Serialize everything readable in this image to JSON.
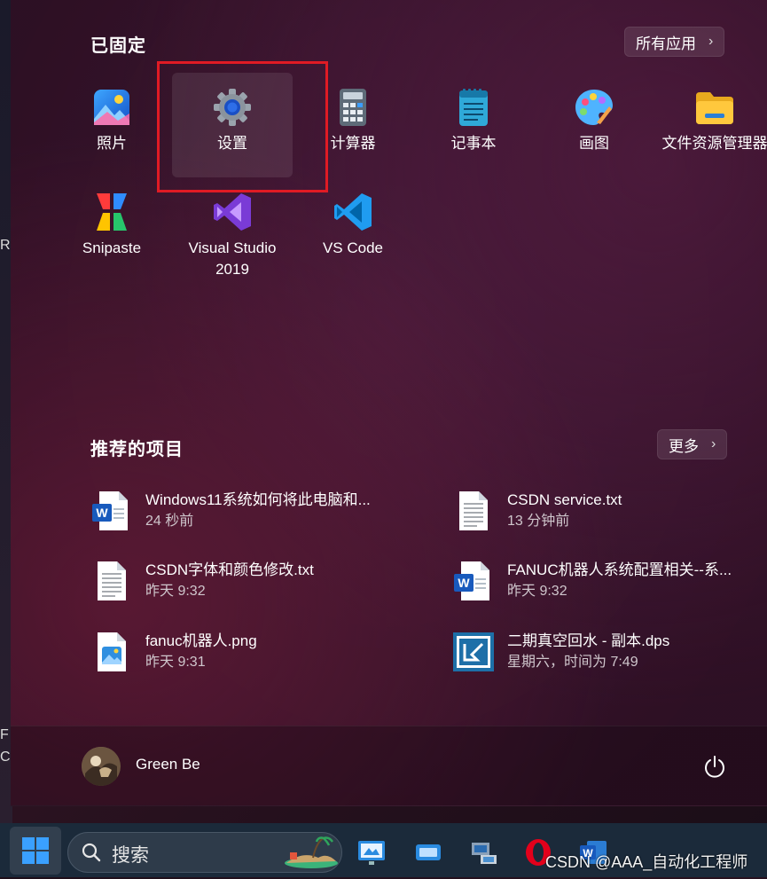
{
  "desktop": {
    "chars": [
      "R",
      "F",
      "C"
    ]
  },
  "pinned": {
    "title": "已固定",
    "all_apps": "所有应用",
    "apps": [
      {
        "label": "照片",
        "icon": "photos-icon"
      },
      {
        "label": "设置",
        "icon": "gear-icon",
        "selected": true
      },
      {
        "label": "计算器",
        "icon": "calculator-icon"
      },
      {
        "label": "记事本",
        "icon": "notepad-icon"
      },
      {
        "label": "画图",
        "icon": "paint-icon"
      },
      {
        "label": "文件资源管理器",
        "icon": "folder-icon"
      },
      {
        "label": "Snipaste",
        "icon": "snipaste-icon"
      },
      {
        "label": "Visual Studio 2019",
        "label_line1": "Visual Studio",
        "label_line2": "2019",
        "icon": "visual-studio-icon"
      },
      {
        "label": "VS Code",
        "icon": "vscode-icon"
      }
    ]
  },
  "recommended": {
    "title": "推荐的项目",
    "more": "更多",
    "items": [
      {
        "name": "Windows11系统如何将此电脑和...",
        "time": "24 秒前",
        "icon": "word-doc-icon"
      },
      {
        "name": "CSDN service.txt",
        "time": "13 分钟前",
        "icon": "text-file-icon"
      },
      {
        "name": "CSDN字体和颜色修改.txt",
        "time": "昨天 9:32",
        "icon": "text-file-icon"
      },
      {
        "name": "FANUC机器人系统配置相关--系...",
        "time": "昨天 9:32",
        "icon": "word-doc-icon"
      },
      {
        "name": "fanuc机器人.png",
        "time": "昨天 9:31",
        "icon": "image-file-icon"
      },
      {
        "name": "二期真空回水 - 副本.dps",
        "time": "星期六，时间为 7:49",
        "icon": "dps-file-icon"
      }
    ]
  },
  "user": {
    "name": "Green Be"
  },
  "taskbar": {
    "search_label": "搜索"
  },
  "watermark": "CSDN @AAA_自动化工程师",
  "colors": {
    "highlight_border": "#e01b24",
    "taskbar": "#1b2a3a"
  }
}
